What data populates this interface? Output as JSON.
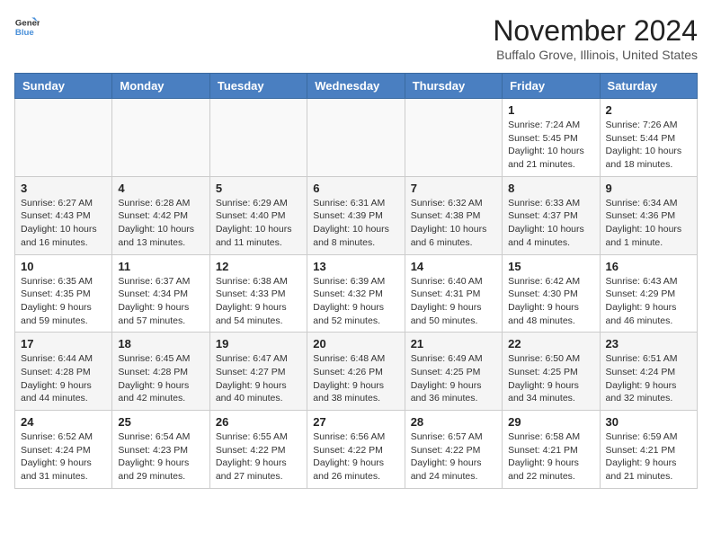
{
  "logo": {
    "line1": "General",
    "line2": "Blue"
  },
  "title": "November 2024",
  "location": "Buffalo Grove, Illinois, United States",
  "columns": [
    "Sunday",
    "Monday",
    "Tuesday",
    "Wednesday",
    "Thursday",
    "Friday",
    "Saturday"
  ],
  "weeks": [
    [
      {
        "day": "",
        "info": ""
      },
      {
        "day": "",
        "info": ""
      },
      {
        "day": "",
        "info": ""
      },
      {
        "day": "",
        "info": ""
      },
      {
        "day": "",
        "info": ""
      },
      {
        "day": "1",
        "info": "Sunrise: 7:24 AM\nSunset: 5:45 PM\nDaylight: 10 hours and 21 minutes."
      },
      {
        "day": "2",
        "info": "Sunrise: 7:26 AM\nSunset: 5:44 PM\nDaylight: 10 hours and 18 minutes."
      }
    ],
    [
      {
        "day": "3",
        "info": "Sunrise: 6:27 AM\nSunset: 4:43 PM\nDaylight: 10 hours and 16 minutes."
      },
      {
        "day": "4",
        "info": "Sunrise: 6:28 AM\nSunset: 4:42 PM\nDaylight: 10 hours and 13 minutes."
      },
      {
        "day": "5",
        "info": "Sunrise: 6:29 AM\nSunset: 4:40 PM\nDaylight: 10 hours and 11 minutes."
      },
      {
        "day": "6",
        "info": "Sunrise: 6:31 AM\nSunset: 4:39 PM\nDaylight: 10 hours and 8 minutes."
      },
      {
        "day": "7",
        "info": "Sunrise: 6:32 AM\nSunset: 4:38 PM\nDaylight: 10 hours and 6 minutes."
      },
      {
        "day": "8",
        "info": "Sunrise: 6:33 AM\nSunset: 4:37 PM\nDaylight: 10 hours and 4 minutes."
      },
      {
        "day": "9",
        "info": "Sunrise: 6:34 AM\nSunset: 4:36 PM\nDaylight: 10 hours and 1 minute."
      }
    ],
    [
      {
        "day": "10",
        "info": "Sunrise: 6:35 AM\nSunset: 4:35 PM\nDaylight: 9 hours and 59 minutes."
      },
      {
        "day": "11",
        "info": "Sunrise: 6:37 AM\nSunset: 4:34 PM\nDaylight: 9 hours and 57 minutes."
      },
      {
        "day": "12",
        "info": "Sunrise: 6:38 AM\nSunset: 4:33 PM\nDaylight: 9 hours and 54 minutes."
      },
      {
        "day": "13",
        "info": "Sunrise: 6:39 AM\nSunset: 4:32 PM\nDaylight: 9 hours and 52 minutes."
      },
      {
        "day": "14",
        "info": "Sunrise: 6:40 AM\nSunset: 4:31 PM\nDaylight: 9 hours and 50 minutes."
      },
      {
        "day": "15",
        "info": "Sunrise: 6:42 AM\nSunset: 4:30 PM\nDaylight: 9 hours and 48 minutes."
      },
      {
        "day": "16",
        "info": "Sunrise: 6:43 AM\nSunset: 4:29 PM\nDaylight: 9 hours and 46 minutes."
      }
    ],
    [
      {
        "day": "17",
        "info": "Sunrise: 6:44 AM\nSunset: 4:28 PM\nDaylight: 9 hours and 44 minutes."
      },
      {
        "day": "18",
        "info": "Sunrise: 6:45 AM\nSunset: 4:28 PM\nDaylight: 9 hours and 42 minutes."
      },
      {
        "day": "19",
        "info": "Sunrise: 6:47 AM\nSunset: 4:27 PM\nDaylight: 9 hours and 40 minutes."
      },
      {
        "day": "20",
        "info": "Sunrise: 6:48 AM\nSunset: 4:26 PM\nDaylight: 9 hours and 38 minutes."
      },
      {
        "day": "21",
        "info": "Sunrise: 6:49 AM\nSunset: 4:25 PM\nDaylight: 9 hours and 36 minutes."
      },
      {
        "day": "22",
        "info": "Sunrise: 6:50 AM\nSunset: 4:25 PM\nDaylight: 9 hours and 34 minutes."
      },
      {
        "day": "23",
        "info": "Sunrise: 6:51 AM\nSunset: 4:24 PM\nDaylight: 9 hours and 32 minutes."
      }
    ],
    [
      {
        "day": "24",
        "info": "Sunrise: 6:52 AM\nSunset: 4:24 PM\nDaylight: 9 hours and 31 minutes."
      },
      {
        "day": "25",
        "info": "Sunrise: 6:54 AM\nSunset: 4:23 PM\nDaylight: 9 hours and 29 minutes."
      },
      {
        "day": "26",
        "info": "Sunrise: 6:55 AM\nSunset: 4:22 PM\nDaylight: 9 hours and 27 minutes."
      },
      {
        "day": "27",
        "info": "Sunrise: 6:56 AM\nSunset: 4:22 PM\nDaylight: 9 hours and 26 minutes."
      },
      {
        "day": "28",
        "info": "Sunrise: 6:57 AM\nSunset: 4:22 PM\nDaylight: 9 hours and 24 minutes."
      },
      {
        "day": "29",
        "info": "Sunrise: 6:58 AM\nSunset: 4:21 PM\nDaylight: 9 hours and 22 minutes."
      },
      {
        "day": "30",
        "info": "Sunrise: 6:59 AM\nSunset: 4:21 PM\nDaylight: 9 hours and 21 minutes."
      }
    ]
  ]
}
